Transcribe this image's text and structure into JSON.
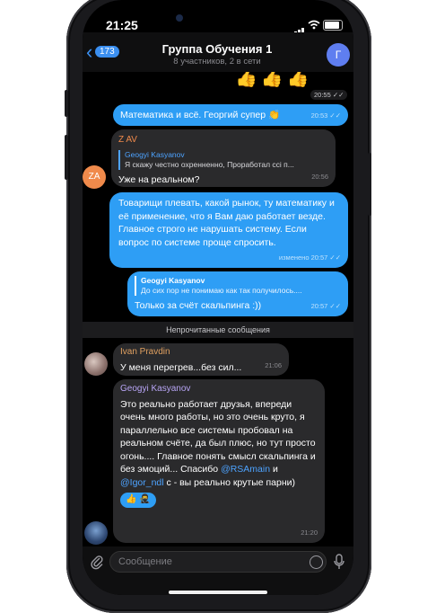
{
  "status_bar": {
    "time": "21:25"
  },
  "header": {
    "back_count": "173",
    "title": "Группа Обучения 1",
    "subtitle": "8 участников, 2 в сети",
    "avatar_letter": "Г"
  },
  "top_message": {
    "emojis": "👍👍👍",
    "time": "20:55"
  },
  "messages": {
    "m1": {
      "text": "Математика и всё. Георгий супер 👏",
      "time": "20:53"
    },
    "m2": {
      "sender": "Z AV",
      "avatar": "ZA",
      "quote_author": "Geogyi Kasyanov",
      "quote_text": "Я скажу честно охренненно, Проработал ссі п...",
      "text": "Уже на реальном?",
      "time": "20:56"
    },
    "m3": {
      "text": "Товарищи плевать, какой рынок, ту математику и её применение, что я Вам даю работает везде. Главное строго не нарушать систему. Если вопрос по системе проще спросить.",
      "time": "изменено 20:57"
    },
    "m4": {
      "quote_author": "Geogyi Kasyanov",
      "quote_text": "До сих пор не понимаю как так получилось....",
      "text": "Только за счёт скальпинга :))",
      "time": "20:57"
    },
    "divider": "Непрочитанные сообщения",
    "m5": {
      "sender": "Ivan Pravdin",
      "text": "У меня перегрев...без сил...",
      "time": "21:06"
    },
    "m6": {
      "sender": "Geogyi Kasyanov",
      "text_part1": "Это реально работает друзья, впереди очень много работы, но это очень круто, я параллельно все системы пробовал на реальном счёте, да был плюс, но тут просто огонь.... Главное понять смысл скальпинга и без эмоций... Спасибо ",
      "mention1": "@RSAmain",
      "text_part2": " и ",
      "mention2": "@Igor_ndl",
      "text_part3": " с - вы реально крутые парни)",
      "reactions": "👍 🥷",
      "time": "21:20"
    }
  },
  "composer": {
    "placeholder": "Сообщение"
  },
  "colors": {
    "accent": "#2e9ef5",
    "incoming": "#2a2a2c",
    "sender_za": "#f08a4b",
    "sender_ivan": "#e0a060",
    "sender_geogyi": "#b8a5f5",
    "mention": "#4da3ff"
  }
}
